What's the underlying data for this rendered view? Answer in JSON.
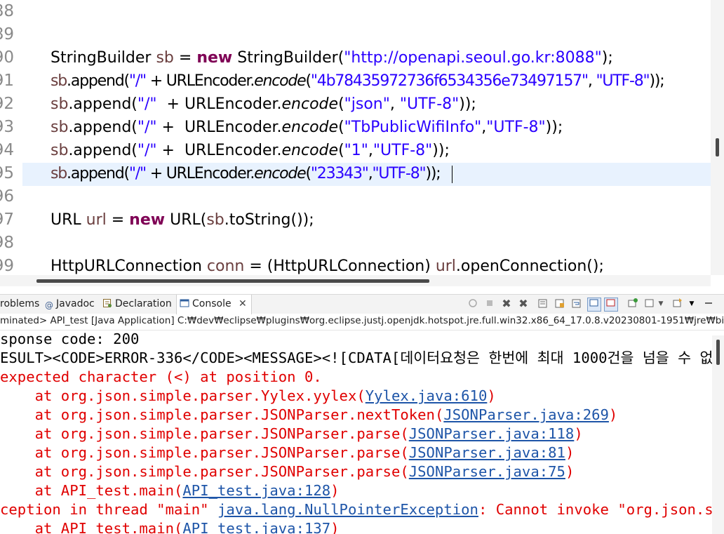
{
  "editor": {
    "line_numbers": [
      "88",
      "89",
      "90",
      "91",
      "92",
      "93",
      "94",
      "95",
      "96",
      "97",
      "98",
      "99"
    ],
    "lines": [
      [],
      [],
      [
        [
          "t",
          "StringBuilder "
        ],
        [
          "v",
          "sb"
        ],
        [
          "t",
          " = "
        ],
        [
          "k",
          "new"
        ],
        [
          "t",
          " StringBuilder("
        ],
        [
          "s",
          "\"http://openapi.seoul.go.kr:8088\""
        ],
        [
          "t",
          ");"
        ]
      ],
      [
        [
          "v",
          "sb"
        ],
        [
          "t",
          ".append("
        ],
        [
          "s",
          "\"/\""
        ],
        [
          "t",
          " + URLEncoder."
        ],
        [
          "i",
          "encode"
        ],
        [
          "t",
          "("
        ],
        [
          "s",
          "\"4b78435972736f6534356e73497157\""
        ],
        [
          "t",
          ", "
        ],
        [
          "s",
          "\"UTF-8\""
        ],
        [
          "t",
          "));"
        ]
      ],
      [
        [
          "v",
          "sb"
        ],
        [
          "t",
          ".append("
        ],
        [
          "s",
          "\"/\""
        ],
        [
          "t",
          "  + URLEncoder."
        ],
        [
          "i",
          "encode"
        ],
        [
          "t",
          "("
        ],
        [
          "s",
          "\"json\""
        ],
        [
          "t",
          ", "
        ],
        [
          "s",
          "\"UTF-8\""
        ],
        [
          "t",
          "));"
        ]
      ],
      [
        [
          "v",
          "sb"
        ],
        [
          "t",
          ".append("
        ],
        [
          "s",
          "\"/\""
        ],
        [
          "t",
          " +  URLEncoder."
        ],
        [
          "i",
          "encode"
        ],
        [
          "t",
          "("
        ],
        [
          "s",
          "\"TbPublicWifiInfo\""
        ],
        [
          "t",
          ","
        ],
        [
          "s",
          "\"UTF-8\""
        ],
        [
          "t",
          "));"
        ]
      ],
      [
        [
          "v",
          "sb"
        ],
        [
          "t",
          ".append("
        ],
        [
          "s",
          "\"/\""
        ],
        [
          "t",
          " +  URLEncoder."
        ],
        [
          "i",
          "encode"
        ],
        [
          "t",
          "("
        ],
        [
          "s",
          "\"1\""
        ],
        [
          "t",
          ","
        ],
        [
          "s",
          "\"UTF-8\""
        ],
        [
          "t",
          "));"
        ]
      ],
      [
        [
          "v",
          "sb"
        ],
        [
          "t",
          ".append("
        ],
        [
          "s",
          "\"/\""
        ],
        [
          "t",
          " + URLEncoder."
        ],
        [
          "i",
          "encode"
        ],
        [
          "t",
          "("
        ],
        [
          "s",
          "\"23343\""
        ],
        [
          "t",
          ","
        ],
        [
          "s",
          "\"UTF-8\""
        ],
        [
          "t",
          "));"
        ]
      ],
      [],
      [
        [
          "t",
          "URL "
        ],
        [
          "v",
          "url"
        ],
        [
          "t",
          " = "
        ],
        [
          "k",
          "new"
        ],
        [
          "t",
          " URL("
        ],
        [
          "v",
          "sb"
        ],
        [
          "t",
          ".toString());"
        ]
      ],
      [],
      [
        [
          "t",
          "HttpURLConnection "
        ],
        [
          "v",
          "conn"
        ],
        [
          "t",
          " = (HttpURLConnection) "
        ],
        [
          "v",
          "url"
        ],
        [
          "t",
          ".openConnection();"
        ]
      ]
    ]
  },
  "tabs": {
    "problems": "roblems",
    "javadoc": "Javadoc",
    "declaration": "Declaration",
    "console": "Console"
  },
  "status_line": "minated> API_test [Java Application] C:₩dev₩eclipse₩plugins₩org.eclipse.justj.openjdk.hotspot.jre.full.win32.x86_64_17.0.8.v20230801-1951₩jre₩bin₩javaw.exe",
  "console": {
    "line1": "sponse code: 200",
    "line2": "ESULT><CODE>ERROR-336</CODE><MESSAGE><![CDATA[데이터요청은 한번에 최대 1000건을 넘을 수 없습니다.]]></MESSAGE></RESULT>",
    "line3": "expected character (<) at position 0.",
    "stack1": [
      {
        "at": "\tat org.json.simple.parser.Yylex.yylex(",
        "link": "Yylex.java:610",
        "end": ")"
      },
      {
        "at": "\tat org.json.simple.parser.JSONParser.nextToken(",
        "link": "JSONParser.java:269",
        "end": ")"
      },
      {
        "at": "\tat org.json.simple.parser.JSONParser.parse(",
        "link": "JSONParser.java:118",
        "end": ")"
      },
      {
        "at": "\tat org.json.simple.parser.JSONParser.parse(",
        "link": "JSONParser.java:81",
        "end": ")"
      },
      {
        "at": "\tat org.json.simple.parser.JSONParser.parse(",
        "link": "JSONParser.java:75",
        "end": ")"
      },
      {
        "at": "\tat API_test.main(",
        "link": "API_test.java:128",
        "end": ")"
      }
    ],
    "exception_prefix": "ception in thread \"main\" ",
    "exception_link": "java.lang.NullPointerException",
    "exception_msg": ": Cannot invoke \"org.json.simple.JSONObject.get(Object)\" because \"jsonObject\" is null",
    "stack2": {
      "at": "\tat API_test.main(",
      "link": "API_test.java:137",
      "end": ")"
    }
  },
  "colors": {
    "keyword": "#7f0055",
    "string": "#2a00ff",
    "field": "#0000c0",
    "variable": "#6a3e3e",
    "error": "#e00000",
    "link": "#1e55a8",
    "highlight": "#e8f2fe"
  },
  "icons": [
    "problems-icon",
    "javadoc-icon",
    "declaration-icon",
    "console-icon",
    "close-icon",
    "terminate-icon",
    "remove-launch-icon",
    "clear-console-icon",
    "scroll-lock-icon",
    "pin-console-icon",
    "display-selected-icon",
    "open-console-icon",
    "chevron-down-icon",
    "minimize-icon"
  ]
}
